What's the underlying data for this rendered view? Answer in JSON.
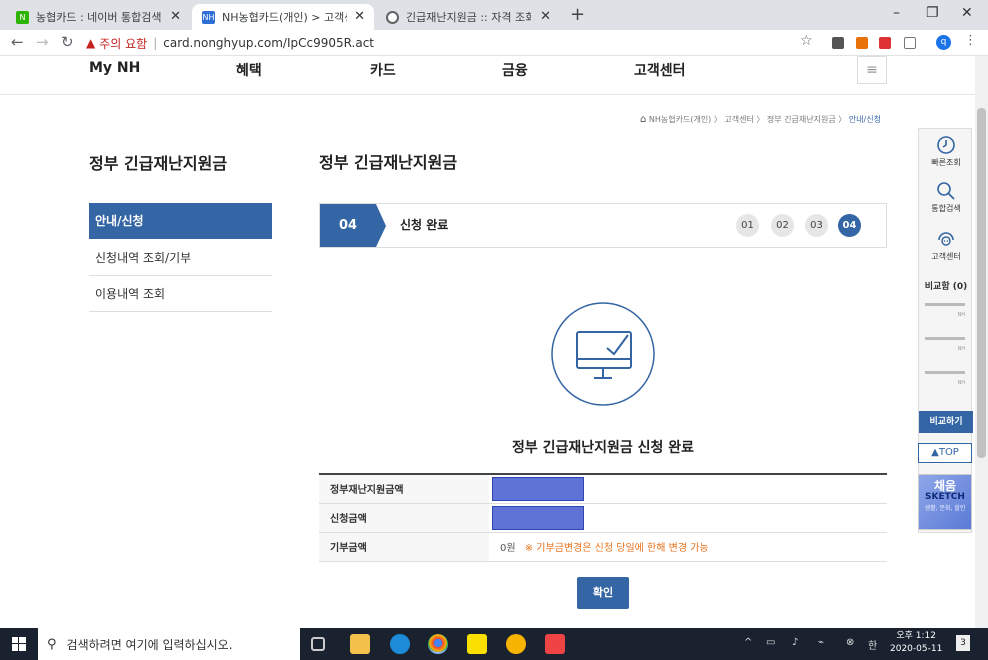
{
  "browser": {
    "tabs": [
      {
        "title": "농협카드 : 네이버 통합검색",
        "favicon_color": "#2db400",
        "favicon_text": "N"
      },
      {
        "title": "NH농협카드(개인) > 고객센터 > 정부",
        "favicon_color": "#2e6fd6",
        "favicon_text": "NH"
      },
      {
        "title": "긴급재난지원금 :: 자격 조회 서비스",
        "favicon_color": "#5f6368",
        "favicon_text": ""
      }
    ],
    "new_tab": "+",
    "window_controls": [
      "–",
      "❐",
      "✕"
    ],
    "security_warning": "주의 요함",
    "url": "card.nonghyup.com/IpCc9905R.act",
    "profile_initial": "q"
  },
  "gnb": [
    "My NH",
    "혜택",
    "카드",
    "금융",
    "고객센터"
  ],
  "breadcrumb": {
    "path": "NH농협카드(개인) 〉 고객센터 〉 정부 긴급재난지원금 〉",
    "current": "안내/신청"
  },
  "sidebar": {
    "title": "정부 긴급재난지원금",
    "items": [
      "안내/신청",
      "신청내역 조회/기부",
      "이용내역 조회"
    ]
  },
  "main": {
    "title": "정부 긴급재난지원금",
    "step": {
      "number": "04",
      "name": "신청 완료",
      "steps": [
        "01",
        "02",
        "03",
        "04"
      ]
    },
    "complete_message": "정부 긴급재난지원금 신청 완료",
    "table": [
      {
        "label": "정부재난지원금액",
        "value": ""
      },
      {
        "label": "신청금액",
        "value": ""
      },
      {
        "label": "기부금액",
        "value": "0원",
        "note": "※ 기부금변경은 신청 당일에 한해 변경 가능"
      }
    ],
    "confirm_button": "확인"
  },
  "quick_menu": {
    "items": [
      "빠른조회",
      "통합검색",
      "고객센터"
    ],
    "compare_title": "비교함 (0)",
    "slot_label": "NH",
    "compare_button": "비교하기",
    "top_button": "▲TOP",
    "banner": {
      "line1": "채움",
      "line2": "SKETCH",
      "line3": "생활, 문화, 할인"
    }
  },
  "taskbar": {
    "search_placeholder": "검색하려면 여기에 입력하십시오.",
    "ampm_time": "오후 1:12",
    "date": "2020-05-11",
    "notification_count": "3"
  }
}
